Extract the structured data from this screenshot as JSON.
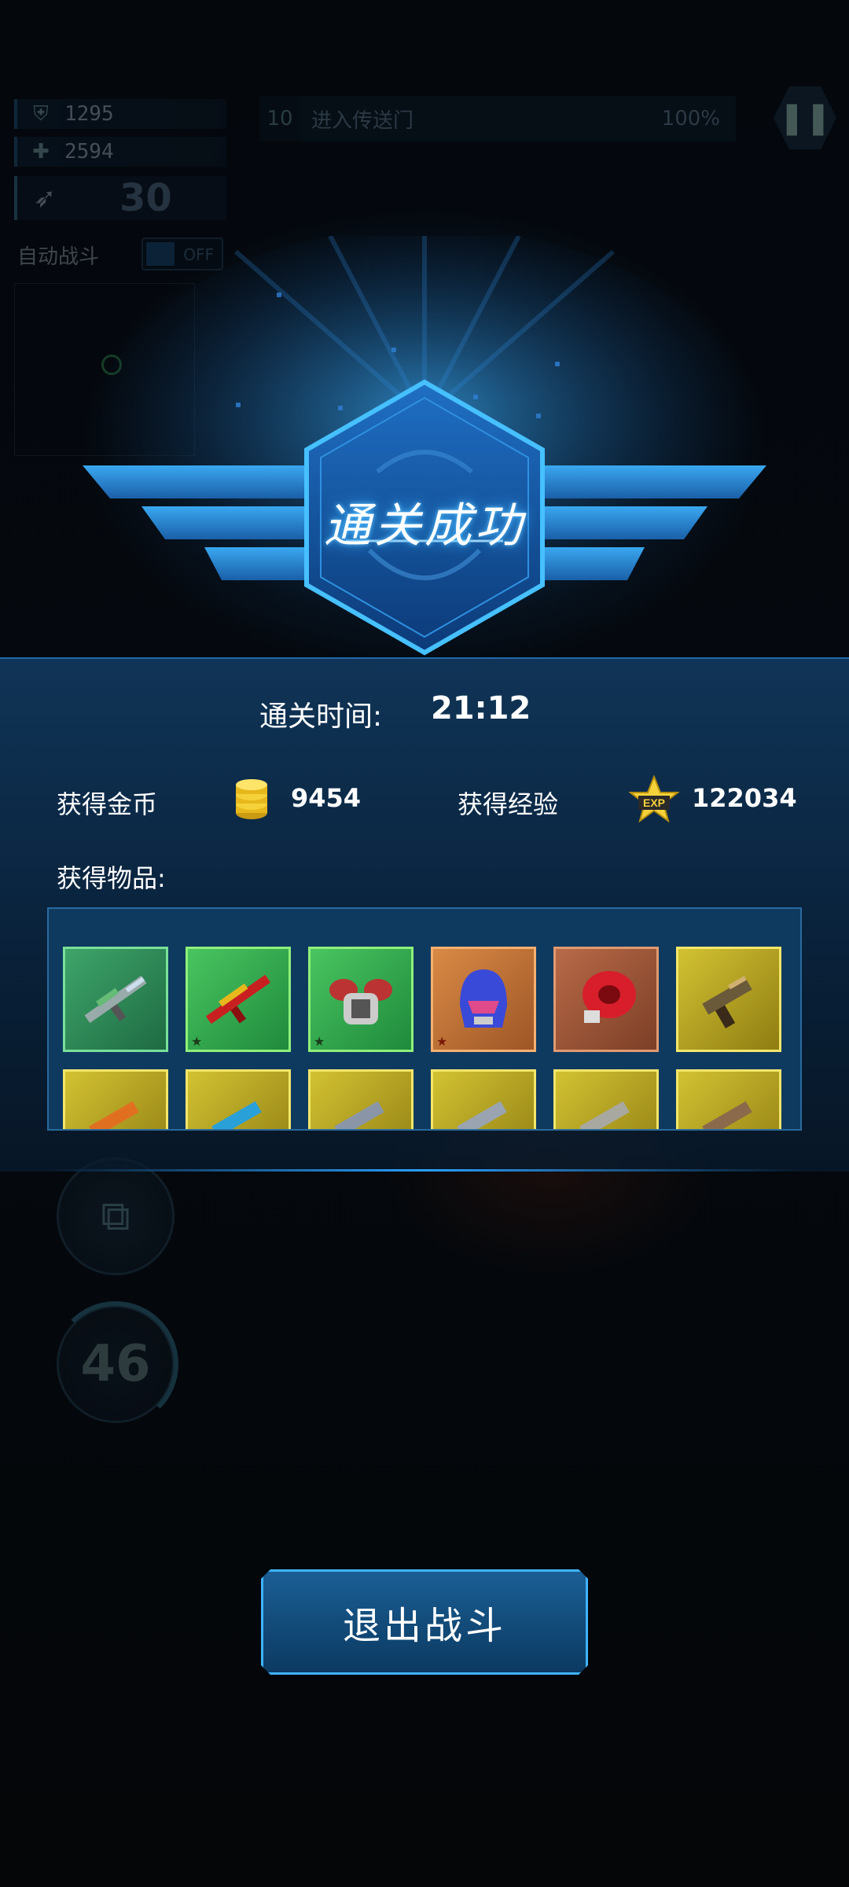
{
  "hud": {
    "armor_value": "1295",
    "health_value": "2594",
    "ammo_value": "30",
    "auto_battle_label": "自动战斗",
    "auto_battle_state": "OFF",
    "quest_number": "10",
    "quest_text": "进入传送门",
    "quest_progress": "100%",
    "grenade_count": "46"
  },
  "result": {
    "title": "通关成功",
    "clear_time_label": "通关时间:",
    "clear_time_value": "21:12",
    "gold_label": "获得金币",
    "gold_value": "9454",
    "exp_label": "获得经验",
    "exp_badge": "EXP",
    "exp_value": "122034",
    "items_label": "获得物品:",
    "items": [
      {
        "name": "green-assault-rifle",
        "quality": "green",
        "star": false
      },
      {
        "name": "red-rifle",
        "quality": "green2",
        "star": true
      },
      {
        "name": "chest-armor",
        "quality": "green2",
        "star": true
      },
      {
        "name": "blue-helmet",
        "quality": "orange",
        "star": true
      },
      {
        "name": "red-shield-device",
        "quality": "copper",
        "star": false
      },
      {
        "name": "gold-pistol",
        "quality": "yellow",
        "star": false
      },
      {
        "name": "orange-gun",
        "quality": "yellow",
        "star": false
      },
      {
        "name": "blue-gun",
        "quality": "yellow",
        "star": false
      },
      {
        "name": "gray-gun",
        "quality": "yellow",
        "star": false
      },
      {
        "name": "gray-rifle",
        "quality": "yellow",
        "star": false
      },
      {
        "name": "silver-rifle",
        "quality": "yellow",
        "star": false
      },
      {
        "name": "bronze-pistol",
        "quality": "yellow",
        "star": false
      }
    ],
    "exit_label": "退出战斗"
  },
  "colors": {
    "accent_glow": "#3ab0ff",
    "panel_blue": "#0f3a60",
    "gold": "#f5d23a"
  }
}
